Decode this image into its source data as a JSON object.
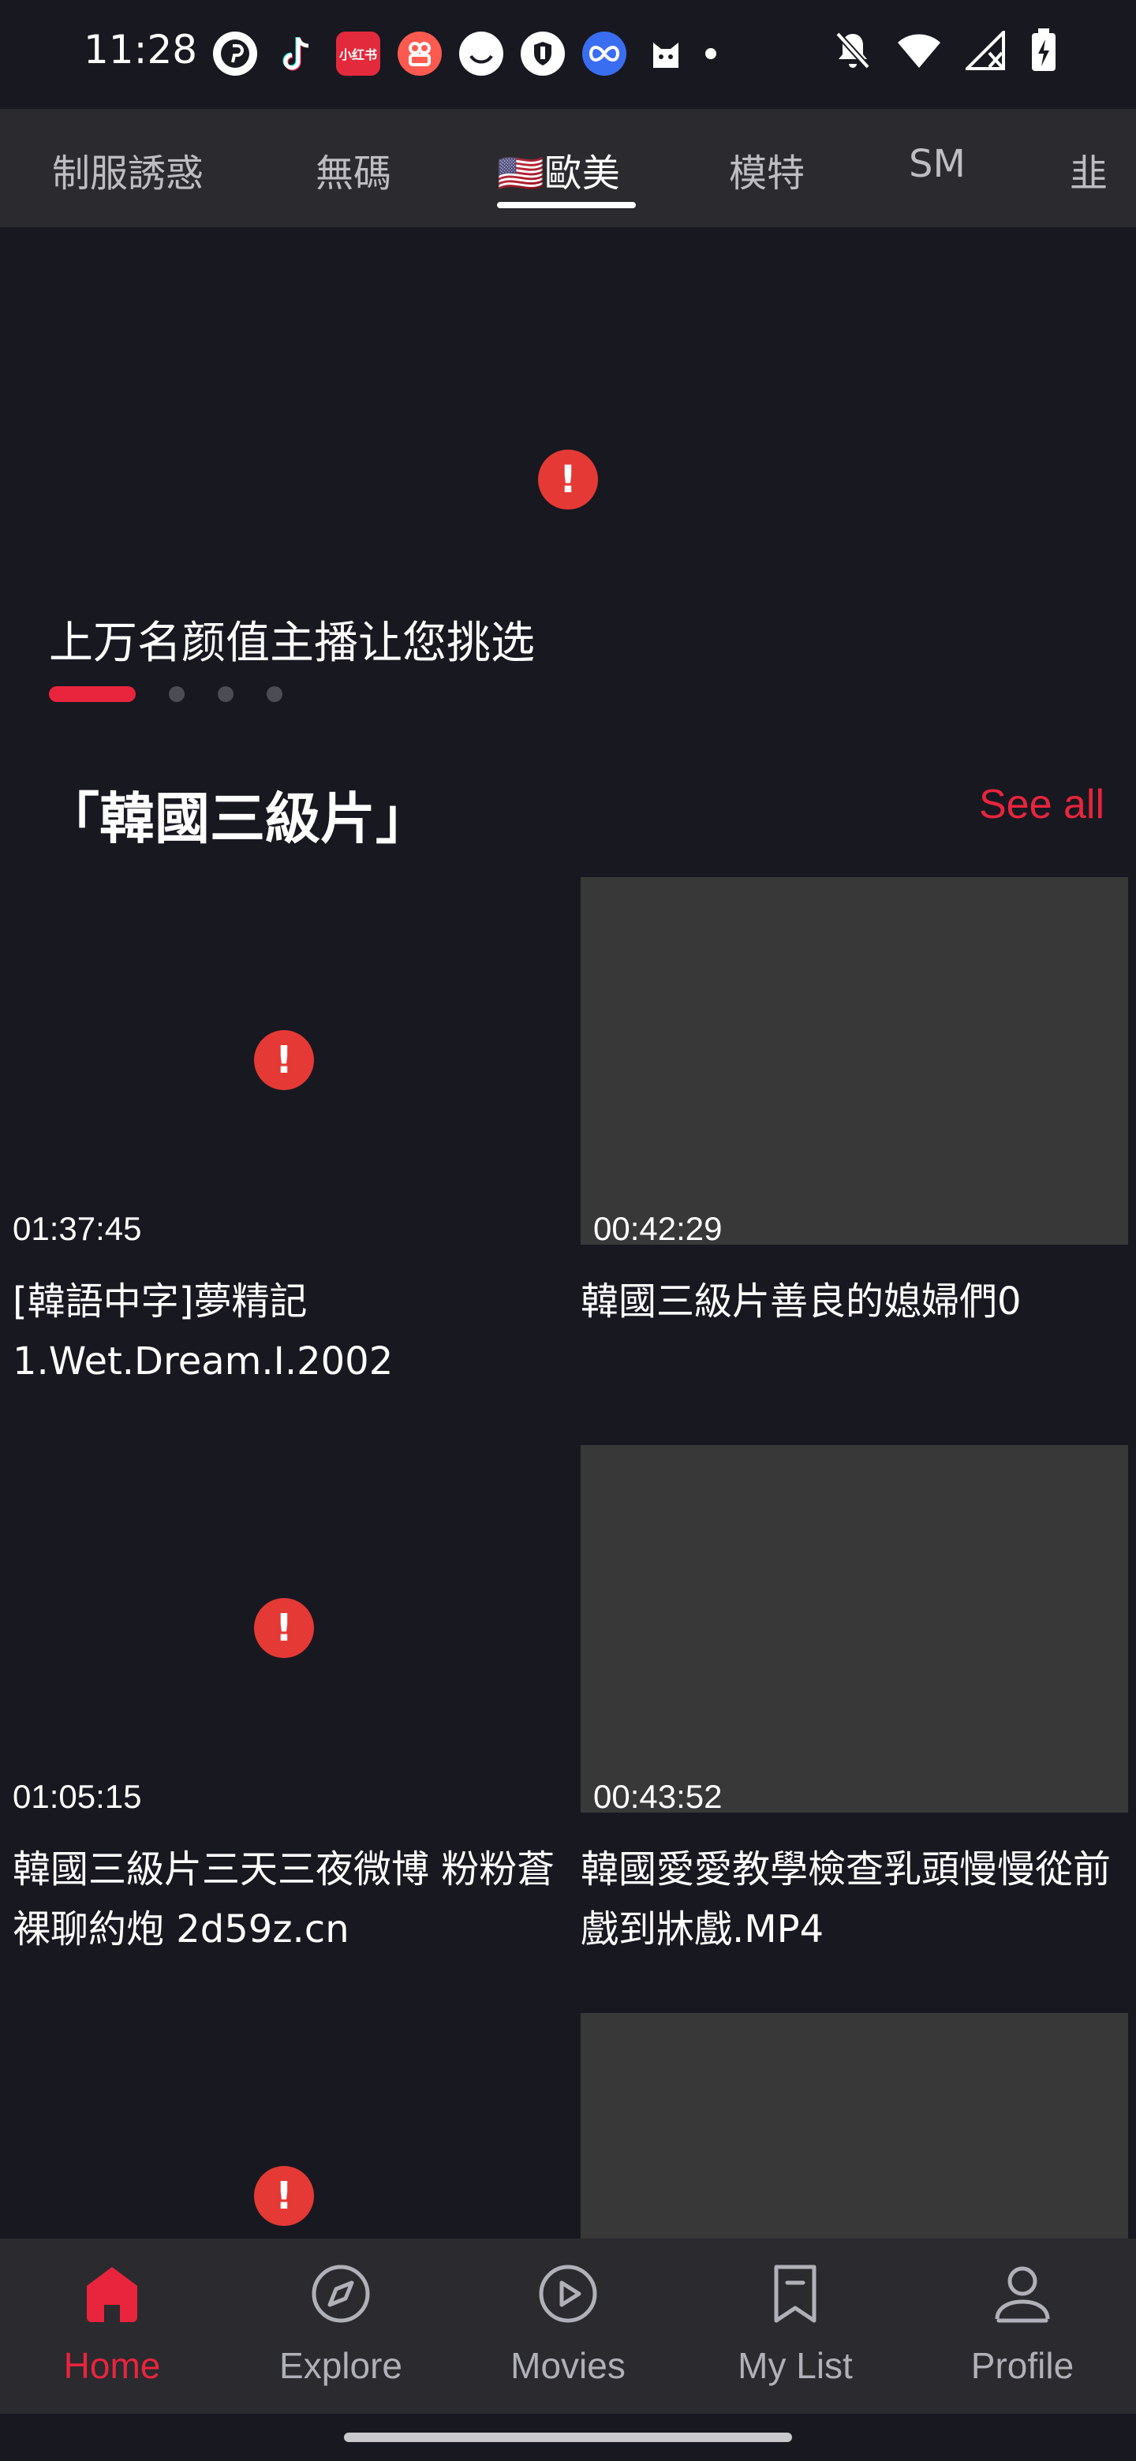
{
  "status_bar": {
    "time": "11:28",
    "app_icons": [
      "pinterest-icon",
      "tiktok-icon",
      "xiaohongshu-icon",
      "kuaishou-icon",
      "ghost-icon",
      "shield-icon",
      "meta-icon",
      "cat-icon"
    ],
    "xhs_label": "小红书"
  },
  "tabs": [
    {
      "label": "制服誘惑",
      "active": false
    },
    {
      "label": "無碼",
      "active": false
    },
    {
      "label": "🇺🇸歐美",
      "active": true
    },
    {
      "label": "模特",
      "active": false
    },
    {
      "label": "SM",
      "active": false
    },
    {
      "label": "韭",
      "active": false
    }
  ],
  "banner": {
    "caption": "上万名颜值主播让您挑选",
    "pages": 4,
    "current_page": 1
  },
  "section": {
    "title": "「韓國三級片」",
    "see_all": "See all"
  },
  "videos": [
    {
      "duration": "01:37:45",
      "title": "[韓語中字]夢精記1.Wet.Dream.I.2002",
      "thumb_failed": true
    },
    {
      "duration": "00:42:29",
      "title": "韓國三級片善良的媳婦們0",
      "thumb_failed": false
    },
    {
      "duration": "01:05:15",
      "title": "韓國三級片三天三夜微博 粉粉蒼 裸聊約炮 2d59z.cn",
      "thumb_failed": true
    },
    {
      "duration": "00:43:52",
      "title": "韓國愛愛教學檢查乳頭慢慢從前戲到牀戲.MP4",
      "thumb_failed": false
    },
    {
      "duration": "",
      "title": "",
      "thumb_failed": true
    },
    {
      "duration": "",
      "title": "",
      "thumb_failed": false
    }
  ],
  "bottom_nav": [
    {
      "label": "Home",
      "icon": "home-icon",
      "active": true
    },
    {
      "label": "Explore",
      "icon": "compass-icon",
      "active": false
    },
    {
      "label": "Movies",
      "icon": "play-icon",
      "active": false
    },
    {
      "label": "My List",
      "icon": "bookmark-icon",
      "active": false
    },
    {
      "label": "Profile",
      "icon": "user-icon",
      "active": false
    }
  ],
  "colors": {
    "accent": "#e8253c",
    "background": "#181821",
    "surface": "#2a2a2f",
    "error": "#e53935"
  }
}
